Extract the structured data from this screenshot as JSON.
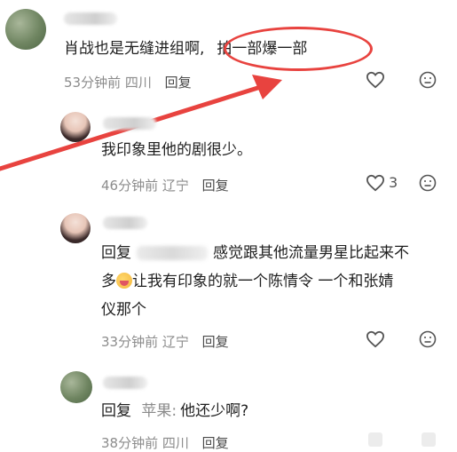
{
  "comments": [
    {
      "text_prefix": "肖战也是无缝进组啊,",
      "text_highlight": "拍一部爆一部",
      "time": "53分钟前",
      "location": "四川",
      "reply_label": "回复"
    },
    {
      "text": "我印象里他的剧很少。",
      "time": "46分钟前",
      "location": "辽宁",
      "reply_label": "回复",
      "like_count": "3"
    },
    {
      "reply_prefix": "回复",
      "line1_rest": "感觉跟其他流量男星比起来不",
      "line2_a": "多",
      "line2_b": "让我有印象的就一个陈情令 一个和张婧",
      "line3": "仪那个",
      "time": "33分钟前",
      "location": "辽宁",
      "reply_label": "回复"
    },
    {
      "reply_prefix": "回复",
      "mention": "苹果:",
      "text": "他还少啊?",
      "time": "38分钟前",
      "location": "四川",
      "reply_label": "回复"
    }
  ],
  "icons": {
    "like": "heart-outline-icon",
    "dislike": "neutral-face-icon",
    "arrow": "red-arrow"
  },
  "colors": {
    "annotation": "#e8433f",
    "meta": "#8c8c8c"
  }
}
